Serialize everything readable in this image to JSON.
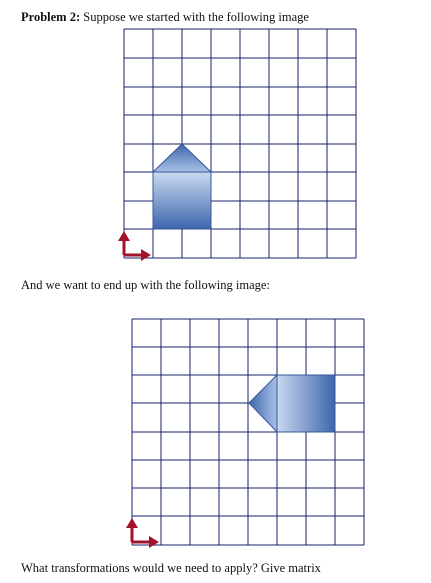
{
  "problem": {
    "label": "Problem 2:",
    "intro": "Suppose we started with the following image",
    "middle": "And we want to end up with the following image:",
    "question": "What transformations would we need to apply? Give matrix"
  },
  "colors": {
    "grid_line": "#1a1f6e",
    "shape_dark": "#3e66ad",
    "shape_light": "#c9d9f0",
    "shape_border": "#35589a",
    "axis_arrow": "#a3122c"
  },
  "icons": {
    "axis": "red-l-shaped-axis-arrows"
  },
  "figures": {
    "start": {
      "description_hidden": true,
      "grid_cols": 8,
      "grid_rows": 8,
      "shape": "house-pointing-up"
    },
    "end": {
      "description_hidden": true,
      "grid_cols": 8,
      "grid_rows": 8,
      "shape": "house-pointing-left"
    }
  }
}
